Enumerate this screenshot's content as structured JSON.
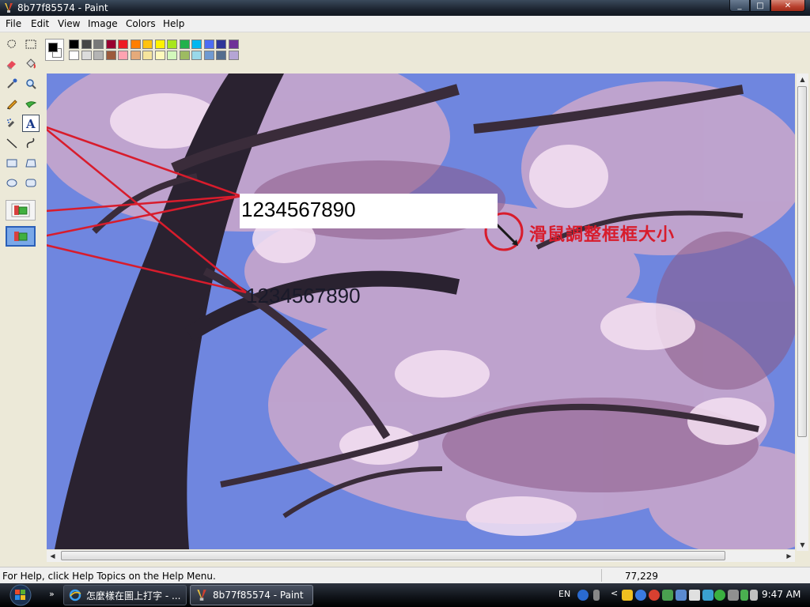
{
  "window": {
    "title": "8b77f85574 - Paint",
    "buttons": [
      "_",
      "□",
      "✕"
    ]
  },
  "menu": [
    "File",
    "Edit",
    "View",
    "Image",
    "Colors",
    "Help"
  ],
  "toolbox": {
    "tools": [
      "free-form-select",
      "select",
      "eraser",
      "fill-with-color",
      "pick-color",
      "magnifier",
      "pencil",
      "brush",
      "airbrush",
      "text",
      "line",
      "curve",
      "rectangle",
      "polygon",
      "ellipse",
      "rounded-rectangle"
    ],
    "selected": "text",
    "text_options": [
      "opaque-background",
      "transparent-background"
    ],
    "active_option": "transparent-background"
  },
  "palette": {
    "foreground": "#000000",
    "background": "#ffffff",
    "row1": [
      "#000000",
      "#464646",
      "#787878",
      "#990030",
      "#ed1c24",
      "#ff7e00",
      "#ffc20e",
      "#fff200",
      "#a8e61d",
      "#22b14c",
      "#00b7ef",
      "#4d6df3",
      "#2f3699",
      "#6f3198"
    ],
    "row2": [
      "#ffffff",
      "#dcdcdc",
      "#b4b4b4",
      "#9c5a3c",
      "#ffa3b1",
      "#e5aa7a",
      "#f5e49c",
      "#fff9bd",
      "#d3f9bc",
      "#9dbb61",
      "#99d9ea",
      "#709ad1",
      "#546d8e",
      "#b5a5d5"
    ]
  },
  "canvas": {
    "text_box_value": "1234567890",
    "text_transparent": "1234567890",
    "annotation": "滑鼠調整框框大小"
  },
  "status": {
    "help": "For Help, click Help Topics on the Help Menu.",
    "coords": "77,229"
  },
  "taskbar": {
    "tasks": [
      {
        "label": "怎麼樣在圖上打字 - ...",
        "icon": "ie-icon",
        "active": false
      },
      {
        "label": "8b77f85574 - Paint",
        "icon": "paint-icon",
        "active": true
      }
    ],
    "tray": {
      "lang": "EN",
      "time": "9:47 AM"
    }
  },
  "colors": {
    "accent_red": "#d81c2c",
    "sky": "#6a7fd8"
  }
}
